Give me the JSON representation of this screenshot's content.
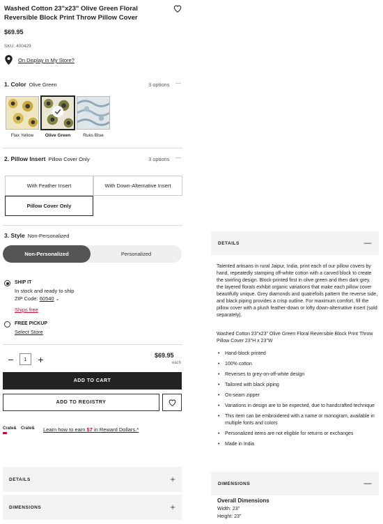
{
  "product": {
    "title": "Washed Cotton 23\"x23\" Olive Green Floral Reversible Block Print Throw Pillow Cover",
    "price": "$69.95",
    "sku": "SKU: 400429",
    "display_link": "On Display in My Store?"
  },
  "color": {
    "heading": "1. Color",
    "selected": "Olive Green",
    "options_count": "3 options",
    "swatches": [
      {
        "label": "Flax Yellow"
      },
      {
        "label": "Olive Green"
      },
      {
        "label": "Ruks Blue"
      }
    ]
  },
  "insert": {
    "heading": "2. Pillow Insert",
    "selected": "Pillow Cover Only",
    "options_count": "3 options",
    "options": [
      "With Feather Insert",
      "With Down-Alternative Insert",
      "Pillow Cover Only"
    ]
  },
  "style": {
    "heading": "3. Style",
    "selected": "Non-Personalized",
    "options": [
      "Non-Personalized",
      "Personalized"
    ]
  },
  "shipping": {
    "ship_label": "SHIP IT",
    "ship_status": "In stock and ready to ship",
    "zip_label": "ZIP Code:",
    "zip_value": "60540",
    "ships_free": "Ships free",
    "pickup_label": "FREE PICKUP",
    "select_store": "Select Store"
  },
  "purchase": {
    "qty": "1",
    "price": "$69.95",
    "unit": "each",
    "add_to_cart": "ADD TO CART",
    "add_to_registry": "ADD TO REGISTRY"
  },
  "rewards": {
    "logo_text": "Crate&",
    "text_before": "Learn how to earn ",
    "amount": "$7",
    "text_after": " in Reward Dollars.*"
  },
  "left_accordions": [
    {
      "label": "DETAILS",
      "symbol": "+"
    },
    {
      "label": "DIMENSIONS",
      "symbol": "+"
    }
  ],
  "details_panel": {
    "heading": "DETAILS",
    "symbol": "—",
    "description": "Talented artisans in rural Jaipur, India, print each of our pillow covers by hand, repeatedly stamping off-white cotton with a carved block to create the swirling design. Block-printed first in olive green and then dark grey, the layered florals exhibit organic variations that make each pillow cover beautifully unique. Grey diamonds and quatrefoils pattern the reverse side, and black piping provides a crisp outline. For maximum comfort, fill the pillow cover with a plush feather-down or lofty down-alternative insert (sold separately).",
    "spec": "Washed Cotton 23\"x23\" Olive Green Floral Reversible Block Print Throw Pillow Cover  23\"H x 23\"W",
    "bullets": [
      "Hand-block printed",
      "100% cotton",
      "Reverses to grey-on-off-white design",
      "Tailored with black piping",
      "On-seam zipper",
      "Variations in design are to be expected, due to handcrafted technique",
      "This item can be embroidered with a name or monogram, available in multiple fonts and colors",
      "Personalized items are not eligible for returns or exchanges",
      "Made in India"
    ]
  },
  "dimensions_panel": {
    "heading": "DIMENSIONS",
    "symbol": "—",
    "title": "Overall Dimensions",
    "width": "Width: 23\"",
    "height": "Height: 23\""
  },
  "colors": {
    "dark": "#222222",
    "toggle_on": "#555555",
    "panel_bg": "#f3f3f3",
    "link_red": "#c8102e"
  }
}
